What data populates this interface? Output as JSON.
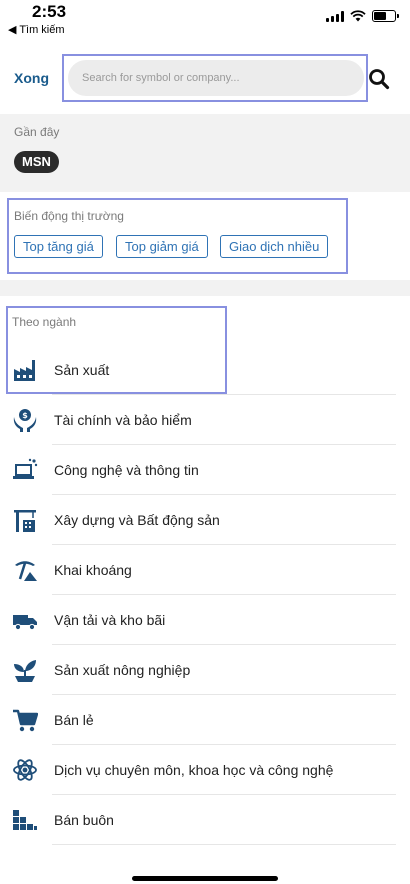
{
  "status_bar": {
    "time": "2:53",
    "back_label": "◀ Tìm kiếm"
  },
  "search": {
    "done_label": "Xong",
    "placeholder": "Search for symbol or company..."
  },
  "recent": {
    "label": "Gần đây",
    "chips": [
      "MSN"
    ]
  },
  "market": {
    "label": "Biến động thị trường",
    "buttons": [
      "Top tăng giá",
      "Top giảm giá",
      "Giao dịch nhiều"
    ]
  },
  "industry": {
    "label": "Theo ngành",
    "items": [
      {
        "label": "Sản xuất",
        "icon": "factory-icon"
      },
      {
        "label": "Tài chính và bảo hiểm",
        "icon": "finance-hands-icon"
      },
      {
        "label": "Công nghệ và thông tin",
        "icon": "laptop-tech-icon"
      },
      {
        "label": "Xây dựng và Bất động sản",
        "icon": "construction-crane-icon"
      },
      {
        "label": "Khai khoáng",
        "icon": "mining-icon"
      },
      {
        "label": "Vận tải và kho bãi",
        "icon": "truck-icon"
      },
      {
        "label": "Sản xuất nông nghiệp",
        "icon": "plant-icon"
      },
      {
        "label": "Bán lẻ",
        "icon": "shopping-cart-icon"
      },
      {
        "label": "Dịch vụ chuyên môn, khoa học và công nghệ",
        "icon": "atom-icon"
      },
      {
        "label": "Bán buôn",
        "icon": "boxes-icon"
      }
    ]
  },
  "colors": {
    "accent": "#1a5b8c",
    "button_border": "#2f73b5",
    "highlight": "#8890e0",
    "band": "#f2f2f2"
  }
}
